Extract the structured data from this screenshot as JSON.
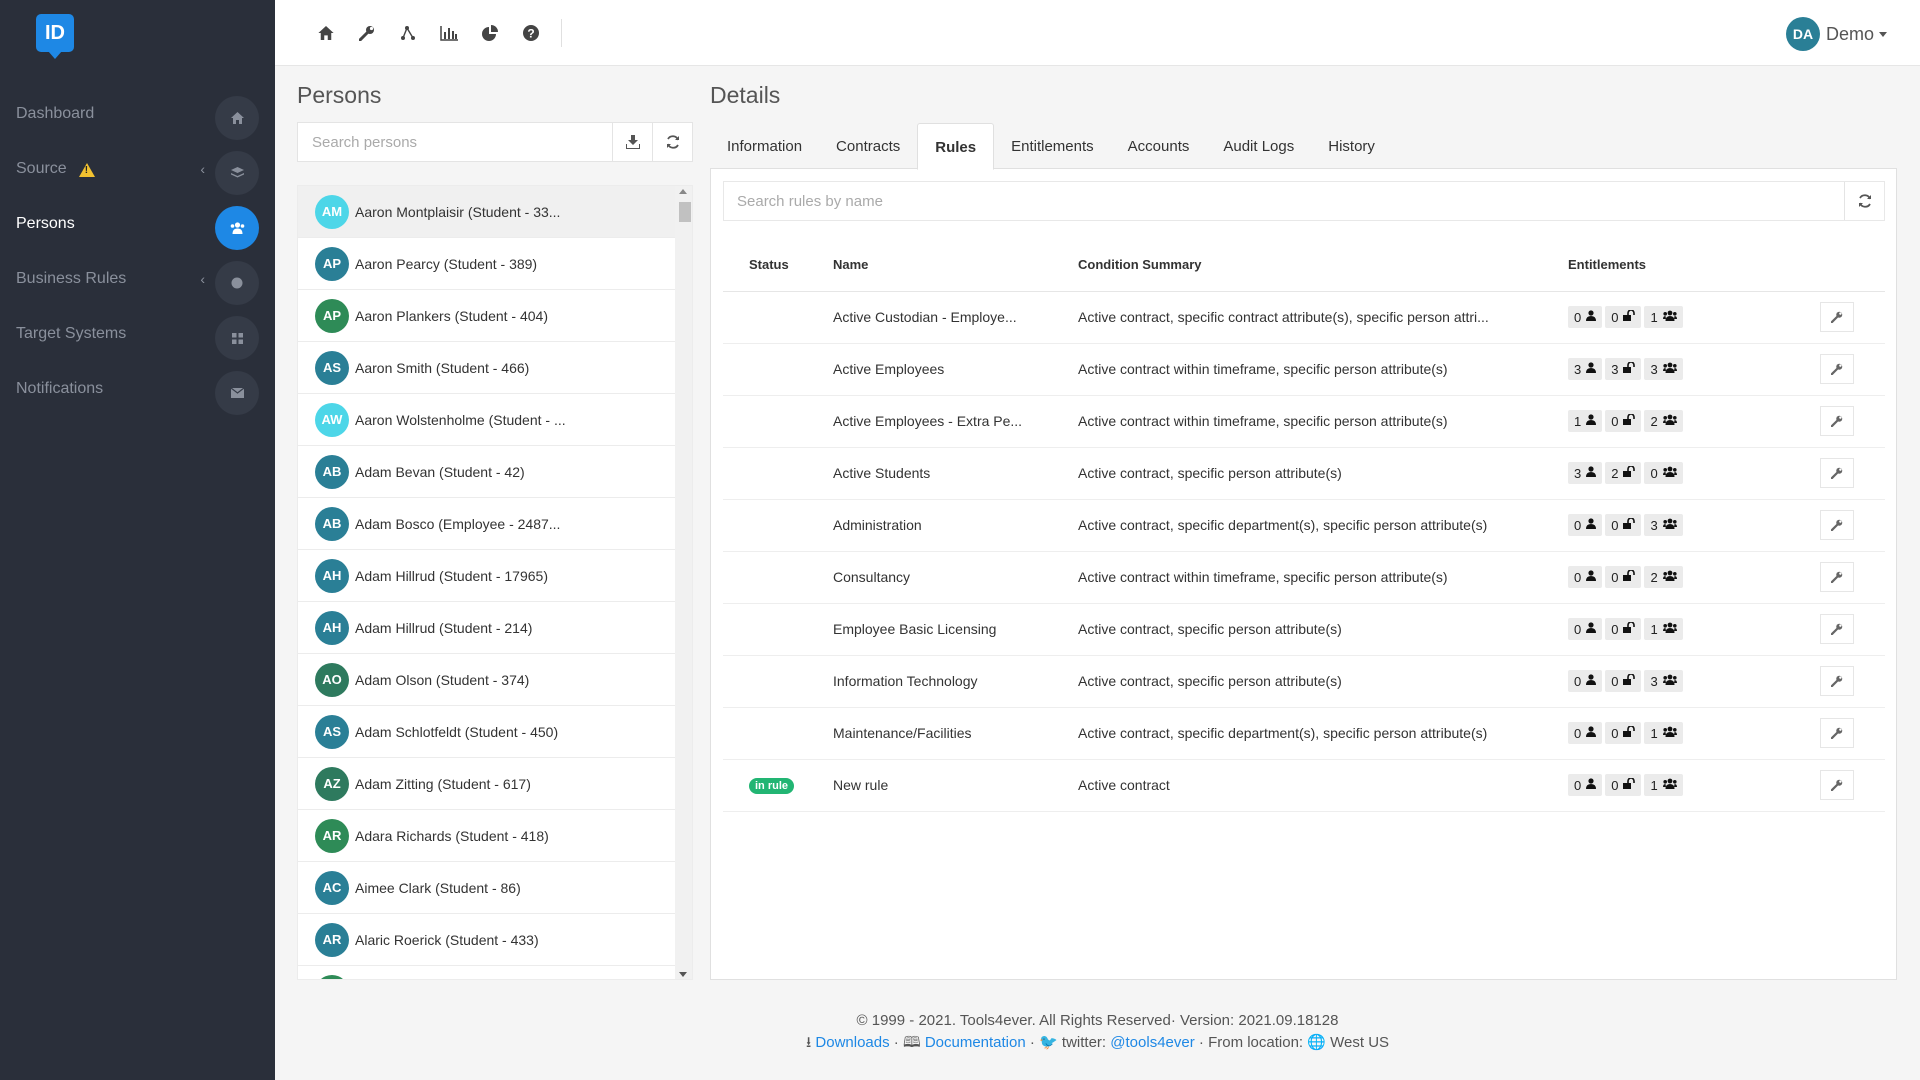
{
  "app": {
    "logo": "ID"
  },
  "sidebar": {
    "items": [
      {
        "label": "Dashboard",
        "icon": "home-icon",
        "active": false
      },
      {
        "label": "Source",
        "icon": "layers-icon",
        "warning": true,
        "chevron": true,
        "active": false
      },
      {
        "label": "Persons",
        "icon": "users-icon",
        "active": true
      },
      {
        "label": "Business Rules",
        "icon": "globe-icon",
        "chevron": true,
        "active": false
      },
      {
        "label": "Target Systems",
        "icon": "grid-icon",
        "active": false
      },
      {
        "label": "Notifications",
        "icon": "envelope-icon",
        "active": false
      }
    ]
  },
  "topbar": {
    "icons": [
      "home-icon",
      "wrench-icon",
      "diagram-icon",
      "bar-chart-icon",
      "pie-chart-icon",
      "help-icon"
    ],
    "user": {
      "initials": "DA",
      "name": "Demo"
    }
  },
  "persons": {
    "title": "Persons",
    "search_placeholder": "Search persons",
    "list": [
      {
        "initials": "AM",
        "name": "Aaron Montplaisir (Student - 33...",
        "color": "#4dd6e8",
        "selected": true
      },
      {
        "initials": "AP",
        "name": "Aaron Pearcy (Student - 389)",
        "color": "#2a7f96"
      },
      {
        "initials": "AP",
        "name": "Aaron Plankers (Student - 404)",
        "color": "#2e8b57"
      },
      {
        "initials": "AS",
        "name": "Aaron Smith (Student - 466)",
        "color": "#2a7f96"
      },
      {
        "initials": "AW",
        "name": "Aaron Wolstenholme (Student - ...",
        "color": "#4dd6e8"
      },
      {
        "initials": "AB",
        "name": "Adam Bevan (Student - 42)",
        "color": "#2a7f96"
      },
      {
        "initials": "AB",
        "name": "Adam Bosco (Employee - 2487...",
        "color": "#2a7f96"
      },
      {
        "initials": "AH",
        "name": "Adam Hillrud (Student - 17965)",
        "color": "#2a7f96"
      },
      {
        "initials": "AH",
        "name": "Adam Hillrud (Student - 214)",
        "color": "#2a7f96"
      },
      {
        "initials": "AO",
        "name": "Adam Olson (Student - 374)",
        "color": "#2e7a5e"
      },
      {
        "initials": "AS",
        "name": "Adam Schlotfeldt (Student - 450)",
        "color": "#2a7f96"
      },
      {
        "initials": "AZ",
        "name": "Adam Zitting (Student - 617)",
        "color": "#2e7a5e"
      },
      {
        "initials": "AR",
        "name": "Adara Richards (Student - 418)",
        "color": "#2e8b57"
      },
      {
        "initials": "AC",
        "name": "Aimee Clark (Student - 86)",
        "color": "#2a7f96"
      },
      {
        "initials": "AR",
        "name": "Alaric Roerick (Student - 433)",
        "color": "#2a7f96"
      },
      {
        "initials": "",
        "name": "",
        "color": "#2e8b57"
      }
    ]
  },
  "details": {
    "title": "Details",
    "tabs": [
      "Information",
      "Contracts",
      "Rules",
      "Entitlements",
      "Accounts",
      "Audit Logs",
      "History"
    ],
    "active_tab": "Rules",
    "rules_search_placeholder": "Search rules by name",
    "columns": {
      "status": "Status",
      "name": "Name",
      "condition": "Condition Summary",
      "entitlements": "Entitlements"
    },
    "rules": [
      {
        "status": "",
        "name": "Active Custodian - Employe...",
        "condition": "Active contract, specific contract attribute(s), specific person attri...",
        "ent": [
          "0",
          "0",
          "1"
        ]
      },
      {
        "status": "",
        "name": "Active Employees",
        "condition": "Active contract within timeframe, specific person attribute(s)",
        "ent": [
          "3",
          "3",
          "3"
        ]
      },
      {
        "status": "",
        "name": "Active Employees - Extra Pe...",
        "condition": "Active contract within timeframe, specific person attribute(s)",
        "ent": [
          "1",
          "0",
          "2"
        ]
      },
      {
        "status": "",
        "name": "Active Students",
        "condition": "Active contract, specific person attribute(s)",
        "ent": [
          "3",
          "2",
          "0"
        ]
      },
      {
        "status": "",
        "name": "Administration",
        "condition": "Active contract, specific department(s), specific person attribute(s)",
        "ent": [
          "0",
          "0",
          "3"
        ]
      },
      {
        "status": "",
        "name": "Consultancy",
        "condition": "Active contract within timeframe, specific person attribute(s)",
        "ent": [
          "0",
          "0",
          "2"
        ]
      },
      {
        "status": "",
        "name": "Employee Basic Licensing",
        "condition": "Active contract, specific person attribute(s)",
        "ent": [
          "0",
          "0",
          "1"
        ]
      },
      {
        "status": "",
        "name": "Information Technology",
        "condition": "Active contract, specific person attribute(s)",
        "ent": [
          "0",
          "0",
          "3"
        ]
      },
      {
        "status": "",
        "name": "Maintenance/Facilities",
        "condition": "Active contract, specific department(s), specific person attribute(s)",
        "ent": [
          "0",
          "0",
          "1"
        ]
      },
      {
        "status": "in rule",
        "name": "New rule",
        "condition": "Active contract",
        "ent": [
          "0",
          "0",
          "1"
        ]
      }
    ]
  },
  "footer": {
    "line1": "© 1999 - 2021. Tools4ever. All Rights Reserved· Version: 2021.09.18128",
    "downloads": "Downloads",
    "documentation": "Documentation",
    "twitter_label": "twitter:",
    "twitter_handle": "@tools4ever",
    "from_location": "From location:",
    "location": "West US"
  },
  "colors": {
    "sidebar_bg": "#2a2f3a",
    "accent": "#1e88e5",
    "in_rule_badge": "#22b573"
  }
}
